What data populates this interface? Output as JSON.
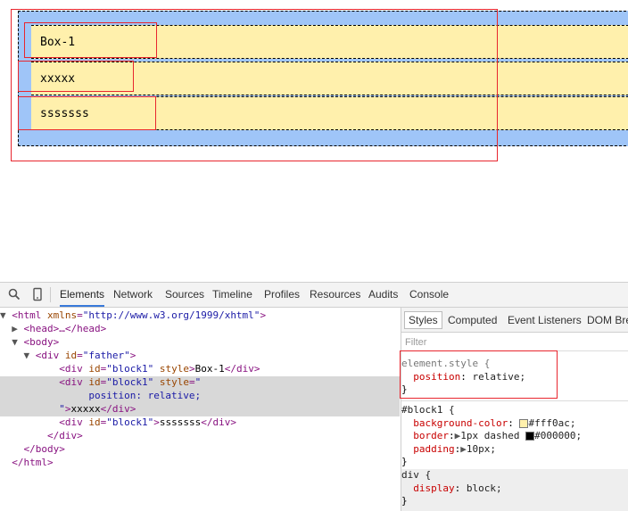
{
  "preview": {
    "blocks": [
      "Box-1",
      "xxxxx",
      "sssssss"
    ]
  },
  "devtools": {
    "tabs": [
      "Elements",
      "Network",
      "Sources",
      "Timeline",
      "Profiles",
      "Resources",
      "Audits",
      "Console"
    ],
    "icons": [
      "search-icon",
      "device-mode-icon"
    ],
    "elements_lines": {
      "l0_tag": "<html",
      "l0_attr": "xmlns",
      "l0_val": "\"http://www.w3.org/1999/xhtml\"",
      "l1": "<head>…</head>",
      "l2": "<body>",
      "l3_tag": "<div",
      "l3_attr": "id",
      "l3_val": "\"father\"",
      "l4_text": "Box-1",
      "l5_style_val": "\"",
      "l6_text": "position: relative;",
      "l7_text": "xxxxx",
      "l8_text": "sssssss",
      "l9": "</div>",
      "l10": "</body>",
      "l11": "</html>",
      "block_id": "\"block1\"",
      "id_attr": "id",
      "style_attr": "style"
    },
    "styles": {
      "tabs": [
        "Styles",
        "Computed",
        "Event Listeners",
        "DOM Bre"
      ],
      "filter": "Filter",
      "element_style": {
        "selector": "element.style {",
        "prop": "position",
        "value": "relative;",
        "close": "}"
      },
      "block1": {
        "selector": "#block1 {",
        "bg_prop": "background-color",
        "bg_value": "#fff0ac;",
        "border_prop": "border",
        "border_value_a": "1px dashed ",
        "border_value_b": "#000000;",
        "padding_prop": "padding",
        "padding_value": "10px;",
        "close": "}"
      },
      "div_rule": {
        "selector": "div {",
        "prop": "display",
        "value": "block;",
        "close": "}"
      }
    },
    "colors": {
      "bg_swatch": "#fff0ac",
      "border_swatch": "#000000"
    }
  }
}
